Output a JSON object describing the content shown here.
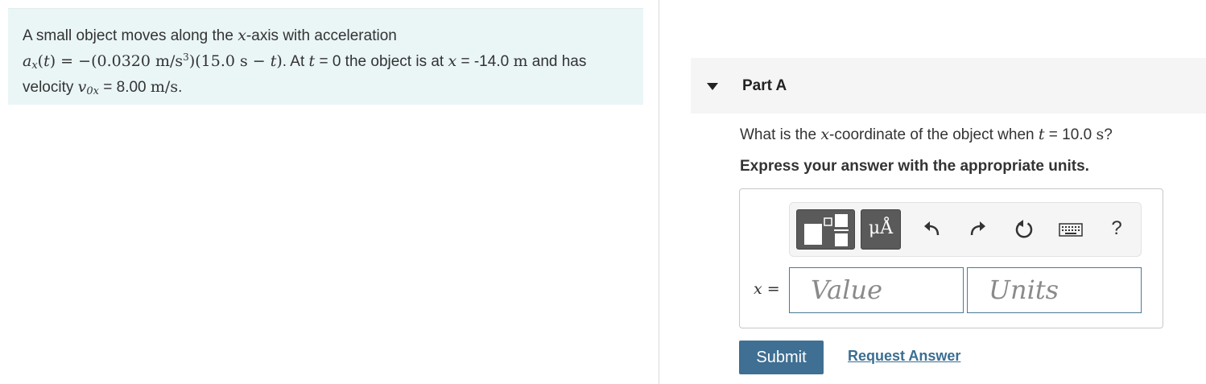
{
  "problem": {
    "line1": "A small object moves along the x-axis with acceleration",
    "line2_math": "aₓ(t) = −(0.0320 m/s³)(15.0 s − t).",
    "line2_text": "At t = 0 the object is at x = -14.0 m and has",
    "line3": "velocity v₀ₓ = 8.00 m/s."
  },
  "part": {
    "title": "Part A",
    "question": "What is the x-coordinate of the object when t = 10.0 s?",
    "instruction": "Express your answer with the appropriate units."
  },
  "toolbar": {
    "units_symbol": "μÅ",
    "help_label": "?",
    "icons": [
      "templates-icon",
      "units-icon",
      "undo-icon",
      "redo-icon",
      "reset-icon",
      "keyboard-icon",
      "help-icon"
    ]
  },
  "answer": {
    "variable_label": "x =",
    "value_placeholder": "Value",
    "units_placeholder": "Units"
  },
  "actions": {
    "submit_label": "Submit",
    "request_label": "Request Answer"
  },
  "colors": {
    "problem_bg": "#eaf5f6",
    "submit_bg": "#3f6f92",
    "link": "#3a6e92",
    "input_border": "#4a7a93"
  }
}
